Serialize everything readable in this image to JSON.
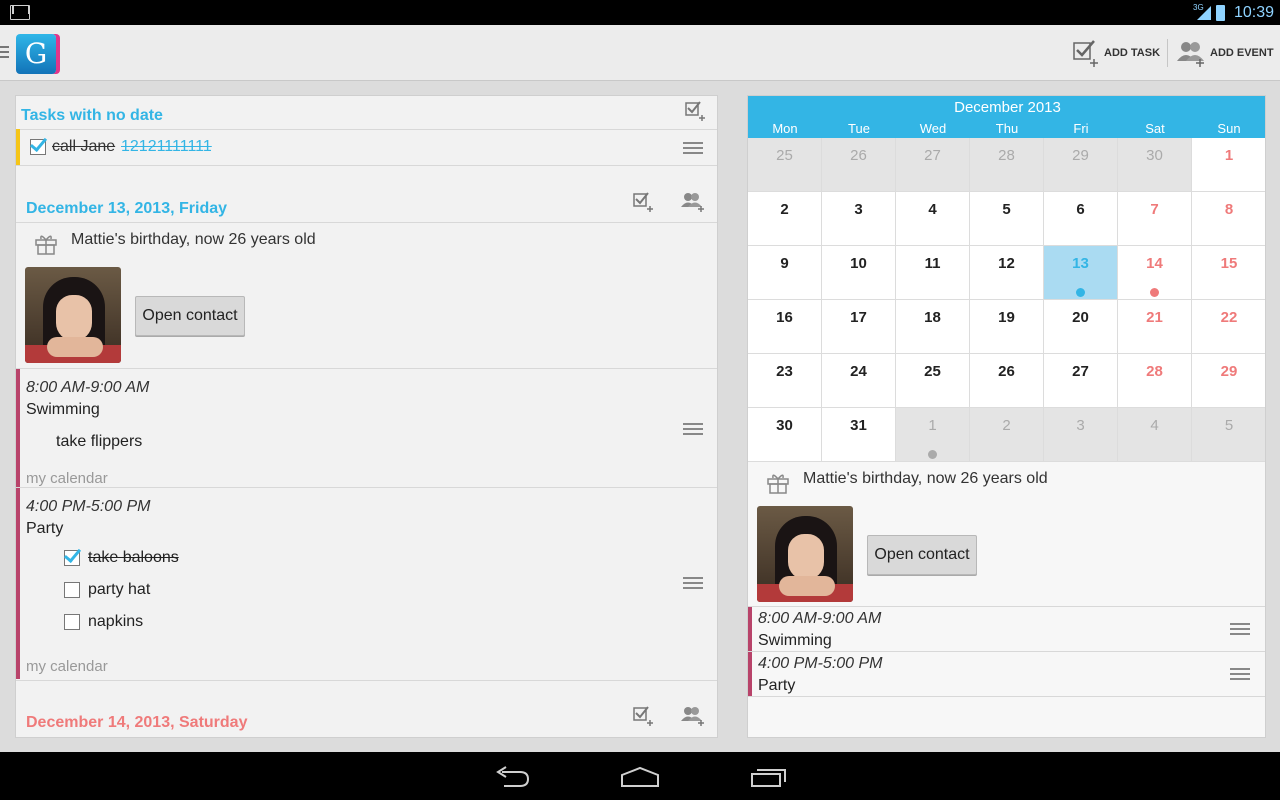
{
  "status_bar": {
    "network": "3G",
    "time": "10:39"
  },
  "action_bar": {
    "logo_letter": "G",
    "add_task": "ADD TASK",
    "add_event": "ADD EVENT"
  },
  "left": {
    "no_date": {
      "title": "Tasks with no date",
      "task": {
        "text": "call Jane ",
        "link": "12121111111",
        "checked": true
      }
    },
    "day1": {
      "title": "December 13, 2013, Friday",
      "birthday": "Mattie's birthday, now 26 years old",
      "open_contact": "Open contact",
      "events": [
        {
          "time": "8:00 AM-9:00 AM",
          "title": "Swimming",
          "subtasks": [
            {
              "text": "take flippers"
            }
          ],
          "calendar": "my calendar"
        },
        {
          "time": "4:00 PM-5:00 PM",
          "title": "Party",
          "subtasks": [
            {
              "text": "take baloons",
              "checked": true
            },
            {
              "text": "party hat",
              "checked": false
            },
            {
              "text": "napkins",
              "checked": false
            }
          ],
          "calendar": "my calendar"
        }
      ]
    },
    "day2": {
      "title": "December 14, 2013, Saturday"
    }
  },
  "calendar": {
    "month": "December 2013",
    "weekdays": [
      "Mon",
      "Tue",
      "Wed",
      "Thu",
      "Fri",
      "Sat",
      "Sun"
    ],
    "weeks": [
      [
        "25",
        "26",
        "27",
        "28",
        "29",
        "30",
        "1"
      ],
      [
        "2",
        "3",
        "4",
        "5",
        "6",
        "7",
        "8"
      ],
      [
        "9",
        "10",
        "11",
        "12",
        "13",
        "14",
        "15"
      ],
      [
        "16",
        "17",
        "18",
        "19",
        "20",
        "21",
        "22"
      ],
      [
        "23",
        "24",
        "25",
        "26",
        "27",
        "28",
        "29"
      ],
      [
        "30",
        "31",
        "1",
        "2",
        "3",
        "4",
        "5"
      ]
    ],
    "selected_day": "13",
    "colors": {
      "accent": "#33b5e5",
      "weekend": "#ef7a7a",
      "event_bar": "#b8436a",
      "undated_bar": "#f5c518"
    }
  },
  "right_detail": {
    "birthday": "Mattie's birthday, now 26 years old",
    "open_contact": "Open contact",
    "events": [
      {
        "time": "8:00 AM-9:00 AM",
        "title": "Swimming"
      },
      {
        "time": "4:00 PM-5:00 PM",
        "title": "Party"
      }
    ]
  }
}
